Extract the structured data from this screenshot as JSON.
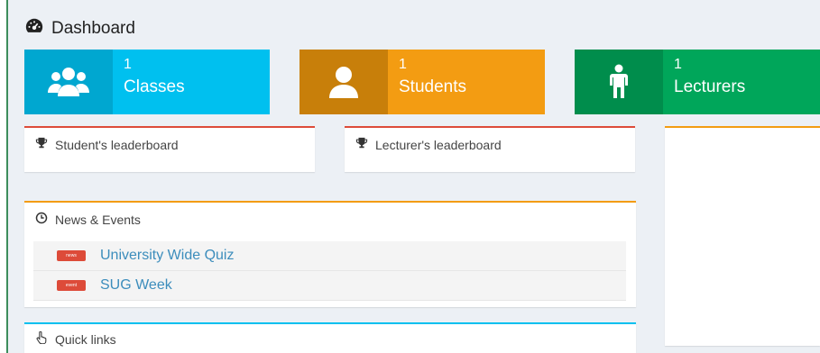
{
  "header": {
    "title": "Dashboard",
    "icon": "dashboard-icon"
  },
  "stats": [
    {
      "count": "1",
      "label": "Classes",
      "icon": "users-icon",
      "color": "#00c0ef"
    },
    {
      "count": "1",
      "label": "Students",
      "icon": "user-icon",
      "color": "#f39c12"
    },
    {
      "count": "1",
      "label": "Lecturers",
      "icon": "male-icon",
      "color": "#00a65a"
    }
  ],
  "leaderboards": {
    "student_title": "Student's leaderboard",
    "lecturer_title": "Lecturer's leaderboard",
    "icon": "trophy-icon",
    "accent": "#dd4b39"
  },
  "news": {
    "title": "News & Events",
    "icon": "clock-icon",
    "items": [
      {
        "tag": "news",
        "text": "University Wide Quiz"
      },
      {
        "tag": "event",
        "text": "SUG Week"
      }
    ]
  },
  "quick_links": {
    "title": "Quick links",
    "icon": "hand-pointer-icon"
  }
}
